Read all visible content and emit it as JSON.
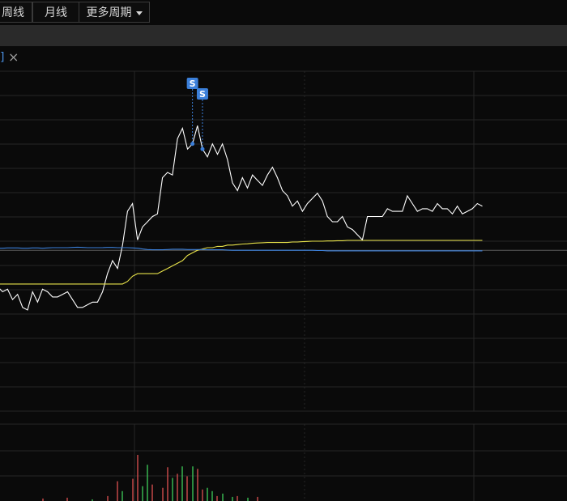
{
  "toolbar": {
    "tabs": [
      {
        "label": "周线"
      },
      {
        "label": "月线"
      },
      {
        "label": "更多周期"
      }
    ]
  },
  "indicator": {
    "bracket": "]",
    "close_glyph": "×"
  },
  "colors": {
    "background": "#0a0a0a",
    "grid": "#262626",
    "price": "#ffffff",
    "ma_yellow": "#e8e34a",
    "ma_blue": "#3b7fd9",
    "baseline": "#5a5a5a",
    "signal": "#3b7fd9",
    "vol_up": "#e05050",
    "vol_down": "#3fcf5a"
  },
  "signals": [
    {
      "label": "S",
      "x_index": 39
    },
    {
      "label": "S",
      "x_index": 41
    }
  ],
  "chart_data": {
    "type": "line",
    "x": [
      0,
      1,
      2,
      3,
      4,
      5,
      6,
      7,
      8,
      9,
      10,
      11,
      12,
      13,
      14,
      15,
      16,
      17,
      18,
      19,
      20,
      21,
      22,
      23,
      24,
      25,
      26,
      27,
      28,
      29,
      30,
      31,
      32,
      33,
      34,
      35,
      36,
      37,
      38,
      39,
      40,
      41,
      42,
      43,
      44,
      45,
      46,
      47,
      48,
      49,
      50,
      51,
      52,
      53,
      54,
      55,
      56,
      57,
      58,
      59,
      60,
      61,
      62,
      63,
      64,
      65,
      66,
      67,
      68,
      69,
      70,
      71,
      72,
      73,
      74,
      75,
      76,
      77,
      78,
      79,
      80,
      81,
      82,
      83,
      84,
      85,
      86,
      87,
      88,
      89,
      90,
      91,
      92,
      93,
      94,
      95,
      96,
      97
    ],
    "series": [
      {
        "values": [
          -1.4,
          -1.6,
          -1.5,
          -1.9,
          -1.7,
          -2.2,
          -2.3,
          -1.6,
          -2.0,
          -1.5,
          -1.6,
          -1.8,
          -1.8,
          -1.7,
          -1.6,
          -1.9,
          -2.2,
          -2.2,
          -2.1,
          -2.0,
          -2.0,
          -1.6,
          -0.9,
          -0.4,
          -0.7,
          0.2,
          1.5,
          1.8,
          0.4,
          0.9,
          1.1,
          1.3,
          1.4,
          2.8,
          3.0,
          2.9,
          4.3,
          4.7,
          3.9,
          4.1,
          4.8,
          3.9,
          3.6,
          4.1,
          3.7,
          4.1,
          3.5,
          2.6,
          2.3,
          2.8,
          2.4,
          2.9,
          2.7,
          2.5,
          2.9,
          3.2,
          2.8,
          2.3,
          2.1,
          1.7,
          1.9,
          1.5,
          1.8,
          2.0,
          2.2,
          1.9,
          1.3,
          1.1,
          1.1,
          1.3,
          0.9,
          0.8,
          0.6,
          0.4,
          1.3,
          1.3,
          1.3,
          1.3,
          1.6,
          1.5,
          1.5,
          1.5,
          2.1,
          1.8,
          1.5,
          1.6,
          1.6,
          1.5,
          1.8,
          1.6,
          1.6,
          1.4,
          1.7,
          1.4,
          1.5,
          1.6,
          1.8,
          1.7
        ]
      },
      {
        "values": [
          -1.3,
          -1.3,
          -1.3,
          -1.3,
          -1.3,
          -1.3,
          -1.3,
          -1.3,
          -1.3,
          -1.3,
          -1.3,
          -1.3,
          -1.3,
          -1.3,
          -1.3,
          -1.3,
          -1.3,
          -1.3,
          -1.3,
          -1.3,
          -1.3,
          -1.3,
          -1.3,
          -1.3,
          -1.3,
          -1.3,
          -1.2,
          -1.0,
          -0.9,
          -0.9,
          -0.9,
          -0.9,
          -0.9,
          -0.8,
          -0.7,
          -0.6,
          -0.5,
          -0.4,
          -0.2,
          -0.1,
          0.0,
          0.05,
          0.1,
          0.1,
          0.15,
          0.15,
          0.2,
          0.2,
          0.22,
          0.24,
          0.25,
          0.27,
          0.28,
          0.29,
          0.3,
          0.3,
          0.3,
          0.3,
          0.3,
          0.32,
          0.32,
          0.33,
          0.34,
          0.35,
          0.35,
          0.35,
          0.36,
          0.36,
          0.37,
          0.37,
          0.38,
          0.38,
          0.38,
          0.38,
          0.38,
          0.38,
          0.38,
          0.38,
          0.38,
          0.38,
          0.38,
          0.38,
          0.38,
          0.38,
          0.38,
          0.38,
          0.38,
          0.38,
          0.38,
          0.38,
          0.38,
          0.38,
          0.38,
          0.38,
          0.38,
          0.38,
          0.38,
          0.38
        ]
      },
      {
        "values": [
          0.08,
          0.08,
          0.09,
          0.09,
          0.09,
          0.08,
          0.08,
          0.09,
          0.09,
          0.08,
          0.09,
          0.1,
          0.1,
          0.1,
          0.1,
          0.11,
          0.12,
          0.11,
          0.1,
          0.1,
          0.1,
          0.1,
          0.11,
          0.11,
          0.1,
          0.1,
          0.1,
          0.09,
          0.08,
          0.05,
          0.03,
          0.02,
          0.02,
          0.02,
          0.03,
          0.04,
          0.04,
          0.04,
          0.03,
          0.03,
          0.03,
          0.03,
          0.02,
          0.02,
          0.02,
          0.02,
          0.01,
          0.0,
          0.0,
          0.0,
          0.0,
          0.0,
          0.0,
          0.0,
          0.0,
          0.0,
          0.0,
          0.0,
          0.0,
          0.0,
          0.0,
          0.0,
          0.0,
          0.0,
          -0.01,
          -0.01,
          -0.02,
          -0.02,
          -0.02,
          -0.02,
          -0.02,
          -0.02,
          -0.02,
          -0.02,
          -0.02,
          -0.02,
          -0.02,
          -0.02,
          -0.02,
          -0.02,
          -0.02,
          -0.02,
          -0.02,
          -0.02,
          -0.02,
          -0.02,
          -0.02,
          -0.02,
          -0.02,
          -0.02,
          -0.02,
          -0.02,
          -0.02,
          -0.02,
          -0.02,
          -0.02,
          -0.02,
          -0.02
        ]
      }
    ],
    "volume": [
      {
        "x": 9,
        "v": 0.3,
        "dir": "up"
      },
      {
        "x": 14,
        "v": 0.4,
        "dir": "up"
      },
      {
        "x": 19,
        "v": 0.2,
        "dir": "down"
      },
      {
        "x": 22,
        "v": 0.6,
        "dir": "up"
      },
      {
        "x": 24,
        "v": 2.4,
        "dir": "up"
      },
      {
        "x": 25,
        "v": 1.2,
        "dir": "down"
      },
      {
        "x": 27,
        "v": 2.7,
        "dir": "up"
      },
      {
        "x": 28,
        "v": 5.6,
        "dir": "up"
      },
      {
        "x": 29,
        "v": 1.8,
        "dir": "down"
      },
      {
        "x": 30,
        "v": 4.4,
        "dir": "down"
      },
      {
        "x": 31,
        "v": 2.0,
        "dir": "up"
      },
      {
        "x": 33,
        "v": 1.6,
        "dir": "up"
      },
      {
        "x": 34,
        "v": 4.1,
        "dir": "up"
      },
      {
        "x": 35,
        "v": 2.8,
        "dir": "down"
      },
      {
        "x": 36,
        "v": 3.3,
        "dir": "up"
      },
      {
        "x": 37,
        "v": 4.2,
        "dir": "down"
      },
      {
        "x": 38,
        "v": 3.0,
        "dir": "up"
      },
      {
        "x": 39,
        "v": 4.2,
        "dir": "down"
      },
      {
        "x": 40,
        "v": 3.9,
        "dir": "up"
      },
      {
        "x": 41,
        "v": 1.4,
        "dir": "up"
      },
      {
        "x": 42,
        "v": 1.6,
        "dir": "down"
      },
      {
        "x": 43,
        "v": 1.2,
        "dir": "down"
      },
      {
        "x": 44,
        "v": 0.6,
        "dir": "up"
      },
      {
        "x": 45,
        "v": 0.9,
        "dir": "down"
      },
      {
        "x": 47,
        "v": 0.5,
        "dir": "down"
      },
      {
        "x": 48,
        "v": 0.6,
        "dir": "up"
      },
      {
        "x": 50,
        "v": 0.4,
        "dir": "down"
      },
      {
        "x": 52,
        "v": 0.5,
        "dir": "up"
      }
    ],
    "ylim": [
      -6.2,
      6.9
    ],
    "vol_max": 5.6,
    "grid": true
  }
}
